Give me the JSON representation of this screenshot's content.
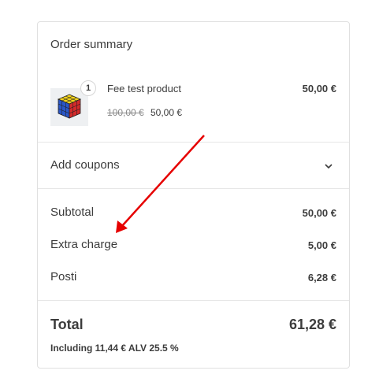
{
  "order_summary": {
    "title": "Order summary",
    "item": {
      "quantity": "1",
      "name": "Fee test product",
      "line_total": "50,00 €",
      "regular_price": "100,00 €",
      "sale_price": "50,00 €",
      "image_icon": "rubiks-cube-icon"
    },
    "coupons": {
      "label": "Add coupons",
      "toggle_icon": "chevron-down-icon"
    },
    "lines": [
      {
        "label": "Subtotal",
        "value": "50,00 €"
      },
      {
        "label": "Extra charge",
        "value": "5,00 €"
      },
      {
        "label": "Posti",
        "value": "6,28 €"
      }
    ],
    "total": {
      "label": "Total",
      "value": "61,28 €",
      "tax_note": "Including 11,44 € ALV 25.5 %"
    }
  },
  "annotation": {
    "arrow_color": "#e60000"
  }
}
